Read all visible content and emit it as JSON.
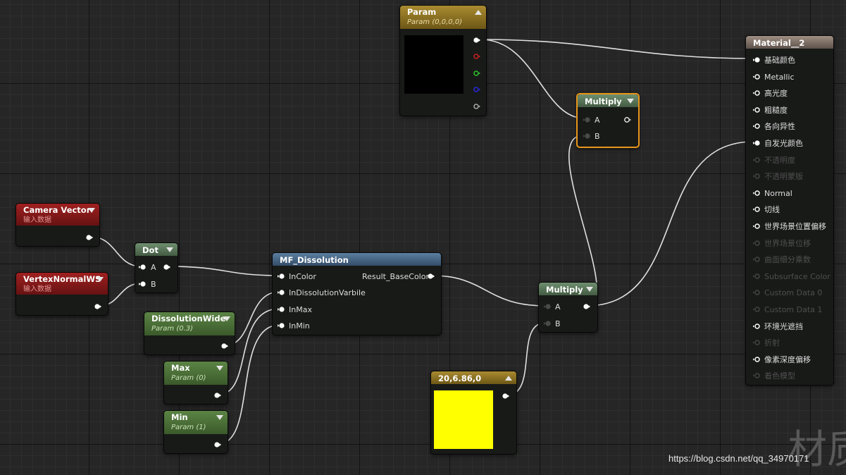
{
  "nodes": {
    "param": {
      "title": "Param",
      "subtitle": "Param (0,0,0,0)"
    },
    "multiply_top": {
      "title": "Multiply",
      "pin_a": "A",
      "pin_b": "B"
    },
    "material": {
      "title": "Material__2",
      "inputs": [
        {
          "label": "基础颜色",
          "enabled": true
        },
        {
          "label": "Metallic",
          "enabled": true
        },
        {
          "label": "高光度",
          "enabled": true
        },
        {
          "label": "粗糙度",
          "enabled": true
        },
        {
          "label": "各向异性",
          "enabled": true
        },
        {
          "label": "自发光颜色",
          "enabled": true
        },
        {
          "label": "不透明度",
          "enabled": false
        },
        {
          "label": "不透明蒙版",
          "enabled": false
        },
        {
          "label": "Normal",
          "enabled": true
        },
        {
          "label": "切线",
          "enabled": true
        },
        {
          "label": "世界场景位置偏移",
          "enabled": true
        },
        {
          "label": "世界场景位移",
          "enabled": false
        },
        {
          "label": "曲面细分乘数",
          "enabled": false
        },
        {
          "label": "Subsurface Color",
          "enabled": false
        },
        {
          "label": "Custom Data 0",
          "enabled": false
        },
        {
          "label": "Custom Data 1",
          "enabled": false
        },
        {
          "label": "环境光遮挡",
          "enabled": true
        },
        {
          "label": "折射",
          "enabled": false
        },
        {
          "label": "像素深度偏移",
          "enabled": true
        },
        {
          "label": "着色模型",
          "enabled": false
        }
      ]
    },
    "camera_vector": {
      "title": "Camera Vector",
      "subtitle": "输入数据"
    },
    "vertex_normal": {
      "title": "VertexNormalWS",
      "subtitle": "输入数据"
    },
    "dot": {
      "title": "Dot",
      "pin_a": "A",
      "pin_b": "B"
    },
    "dissolution": {
      "title": "MF_Dissolution",
      "inputs": [
        "InColor",
        "InDissolutionVarbile",
        "InMax",
        "InMin"
      ],
      "output": "Result_BaseColor"
    },
    "multiply_bottom": {
      "title": "Multiply",
      "pin_a": "A",
      "pin_b": "B"
    },
    "dissolution_wide": {
      "title": "DissolutionWide",
      "subtitle": "Param (0.3)"
    },
    "max": {
      "title": "Max",
      "subtitle": "Param (0)"
    },
    "min": {
      "title": "Min",
      "subtitle": "Param (1)"
    },
    "constant": {
      "title": "20,6.86,0"
    }
  },
  "colors": {
    "param_preview": "#000000",
    "constant_preview": "#ffff00",
    "selection_outline": "#e8951a",
    "wire": "#e0e0e0",
    "pin_red": "#cc2020",
    "pin_green": "#2ec42e",
    "pin_blue": "#2828dd",
    "pin_white": "#ffffff"
  },
  "watermark": "https://blog.csdn.net/qq_34970171",
  "background_text": "材质"
}
